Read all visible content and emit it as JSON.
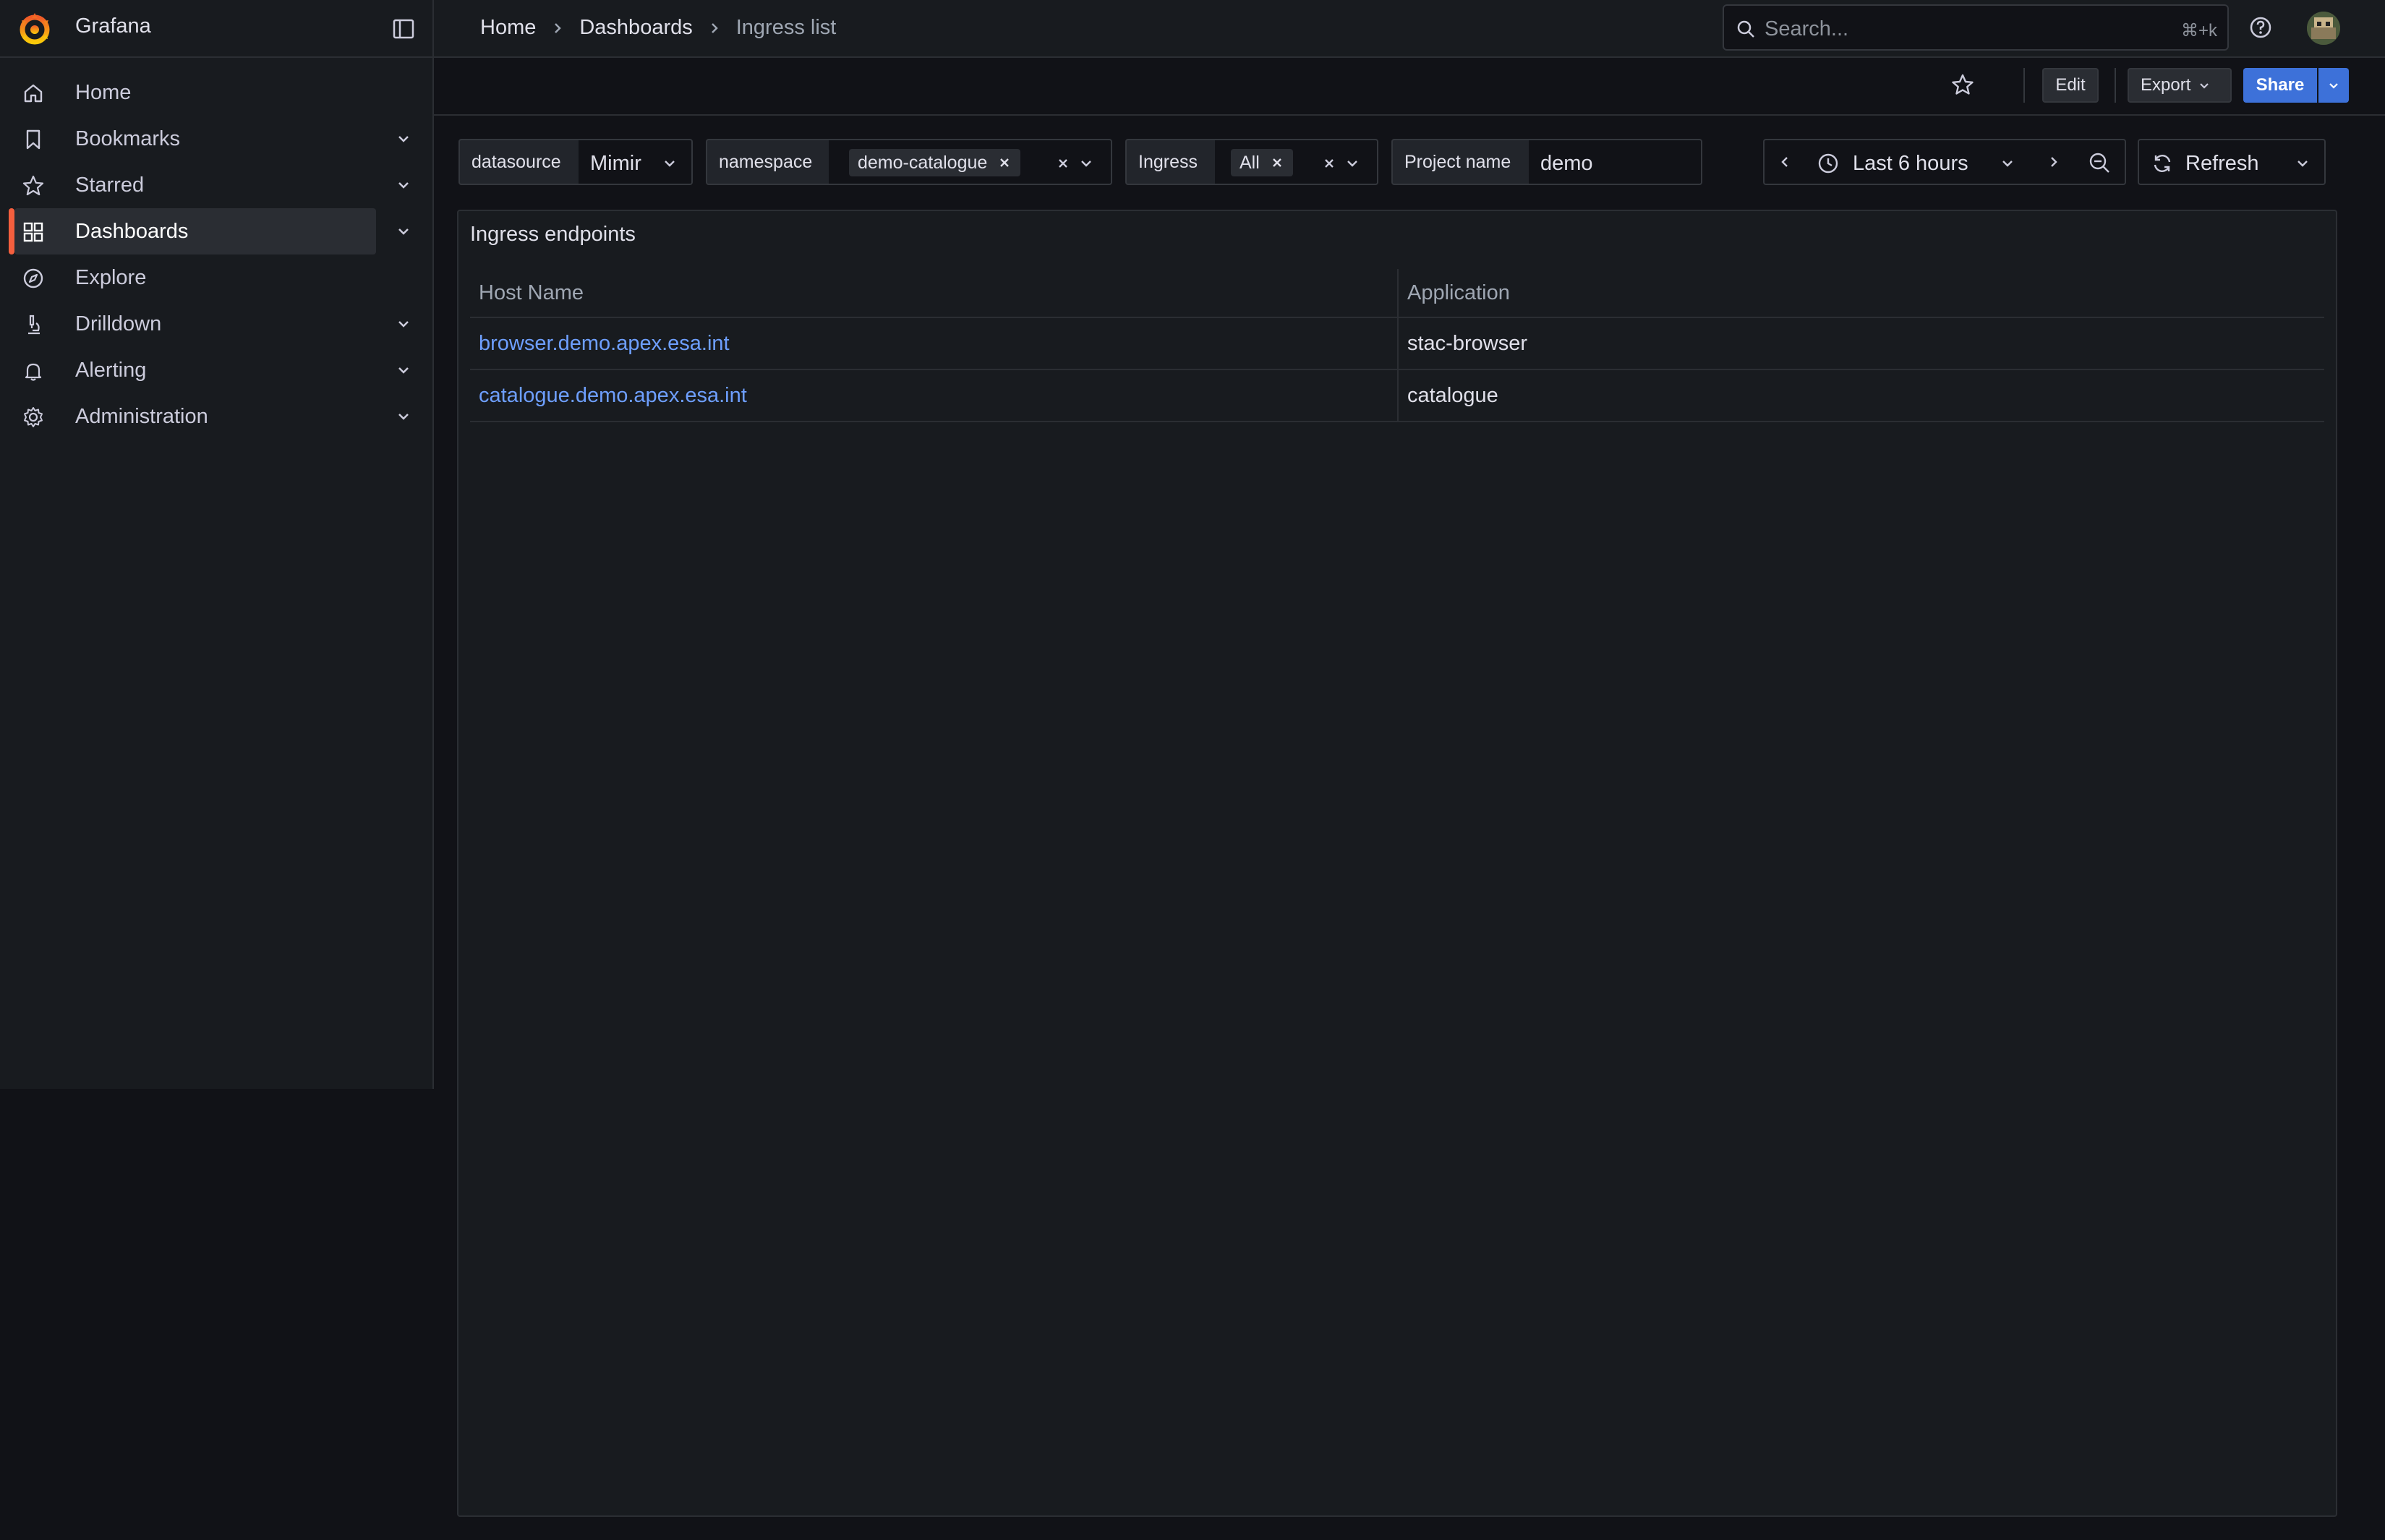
{
  "app": {
    "name": "Grafana"
  },
  "breadcrumb": [
    "Home",
    "Dashboards",
    "Ingress list"
  ],
  "search": {
    "placeholder": "Search...",
    "shortcut": "⌘+k"
  },
  "sidebar": {
    "items": [
      {
        "label": "Home",
        "icon": "home-icon",
        "expandable": false,
        "active": false
      },
      {
        "label": "Bookmarks",
        "icon": "bookmark-icon",
        "expandable": true,
        "active": false
      },
      {
        "label": "Starred",
        "icon": "star-icon",
        "expandable": true,
        "active": false
      },
      {
        "label": "Dashboards",
        "icon": "apps-grid-icon",
        "expandable": true,
        "active": true
      },
      {
        "label": "Explore",
        "icon": "compass-icon",
        "expandable": false,
        "active": false
      },
      {
        "label": "Drilldown",
        "icon": "microscope-icon",
        "expandable": true,
        "active": false
      },
      {
        "label": "Alerting",
        "icon": "bell-icon",
        "expandable": true,
        "active": false
      },
      {
        "label": "Administration",
        "icon": "cog-icon",
        "expandable": true,
        "active": false
      }
    ]
  },
  "toolbar": {
    "edit_label": "Edit",
    "export_label": "Export",
    "share_label": "Share"
  },
  "variables": {
    "datasource": {
      "label": "datasource",
      "value": "Mimir"
    },
    "namespace": {
      "label": "namespace",
      "value": "demo-catalogue"
    },
    "ingress": {
      "label": "Ingress",
      "value": "All"
    },
    "project_name": {
      "label": "Project name",
      "value": "demo"
    }
  },
  "time_range": {
    "label": "Last 6 hours"
  },
  "refresh": {
    "label": "Refresh"
  },
  "panel": {
    "title": "Ingress endpoints",
    "columns": [
      "Host Name",
      "Application"
    ],
    "rows": [
      {
        "host": "browser.demo.apex.esa.int",
        "application": "stac-browser"
      },
      {
        "host": "catalogue.demo.apex.esa.int",
        "application": "catalogue"
      }
    ]
  },
  "colors": {
    "accent": "#f55f3e",
    "primary": "#3d71d9",
    "link": "#6e9fff",
    "background": "#111217",
    "panel": "#181b1f"
  }
}
